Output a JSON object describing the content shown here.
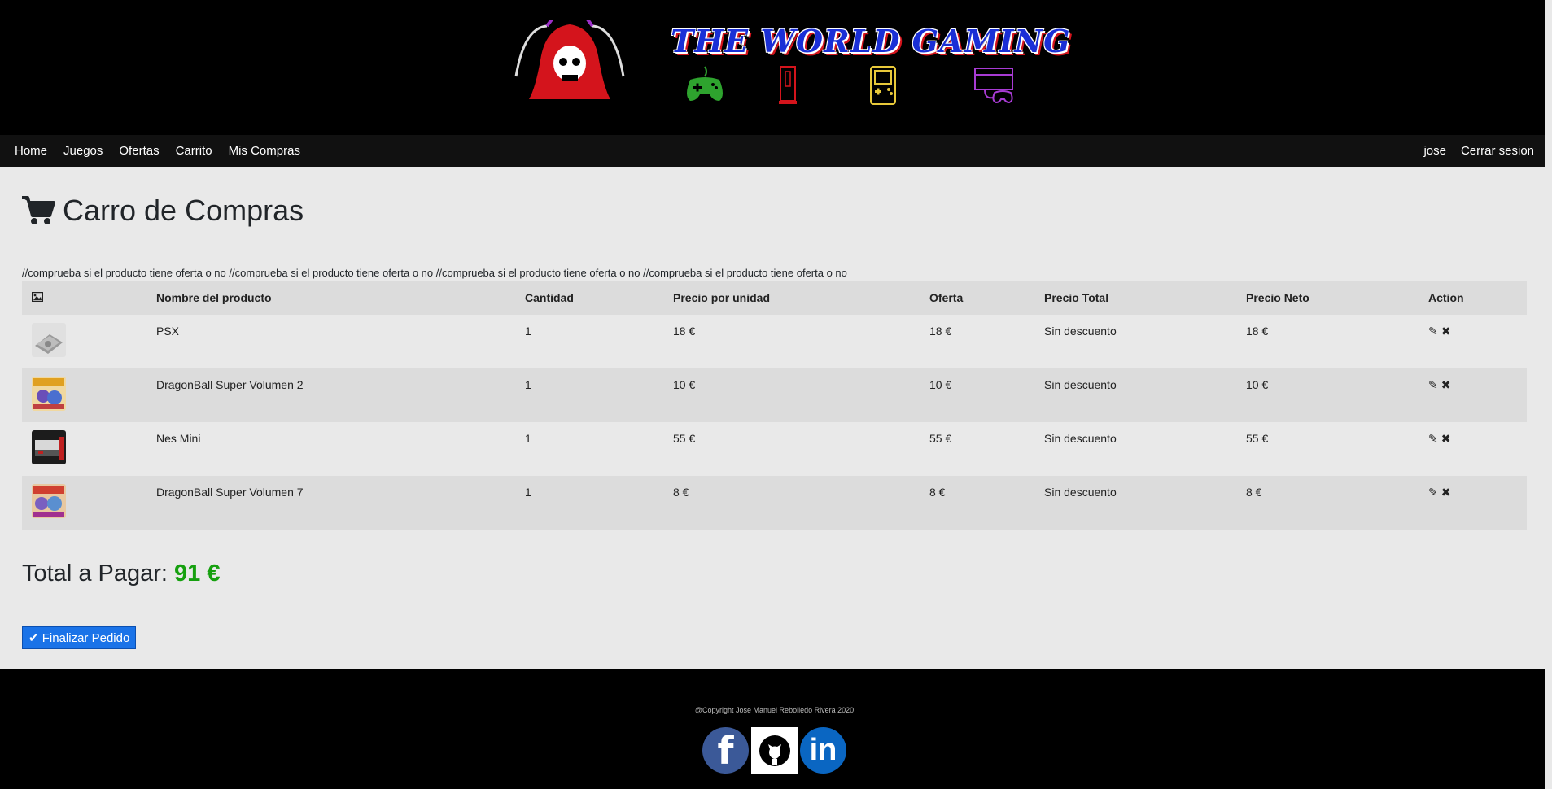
{
  "brand": {
    "title": "THE WORLD GAMING",
    "colors": {
      "title": "#1a2fd6",
      "shadow": "#d4141c",
      "skull": "#d4141c"
    }
  },
  "banner_icons": [
    "gamepad-icon",
    "wii-console-icon",
    "gameboy-icon",
    "retro-console-icon"
  ],
  "nav": {
    "left": [
      "Home",
      "Juegos",
      "Ofertas",
      "Carrito",
      "Mis Compras"
    ],
    "user": "jose",
    "logout": "Cerrar sesion"
  },
  "cart": {
    "title": "Carro de Compras",
    "debug": "//comprueba si el producto tiene oferta o no //comprueba si el producto tiene oferta o no //comprueba si el producto tiene oferta o no //comprueba si el producto tiene oferta o no",
    "columns": [
      "Nombre del producto",
      "Cantidad",
      "Precio por unidad",
      "Oferta",
      "Precio Total",
      "Precio Neto",
      "Action"
    ],
    "rows": [
      {
        "name": "PSX",
        "qty": "1",
        "unit": "18 €",
        "offer": "18 €",
        "total": "Sin descuento",
        "net": "18 €",
        "thumb": "psx-console"
      },
      {
        "name": "DragonBall Super Volumen 2",
        "qty": "1",
        "unit": "10 €",
        "offer": "10 €",
        "total": "Sin descuento",
        "net": "10 €",
        "thumb": "dragonball-manga"
      },
      {
        "name": "Nes Mini",
        "qty": "1",
        "unit": "55 €",
        "offer": "55 €",
        "total": "Sin descuento",
        "net": "55 €",
        "thumb": "nes-mini-box"
      },
      {
        "name": "DragonBall Super Volumen 7",
        "qty": "1",
        "unit": "8 €",
        "offer": "8 €",
        "total": "Sin descuento",
        "net": "8 €",
        "thumb": "dragonball-manga"
      }
    ],
    "total_label": "Total a Pagar:",
    "total_value": "91 €",
    "finalize": "Finalizar Pedido",
    "accent": "#1a73e8",
    "total_color": "#16a00f"
  },
  "footer": {
    "copyright": "@Copyright Jose Manuel Rebolledo Rivera 2020",
    "social": [
      "facebook-icon",
      "github-icon",
      "linkedin-icon"
    ]
  }
}
